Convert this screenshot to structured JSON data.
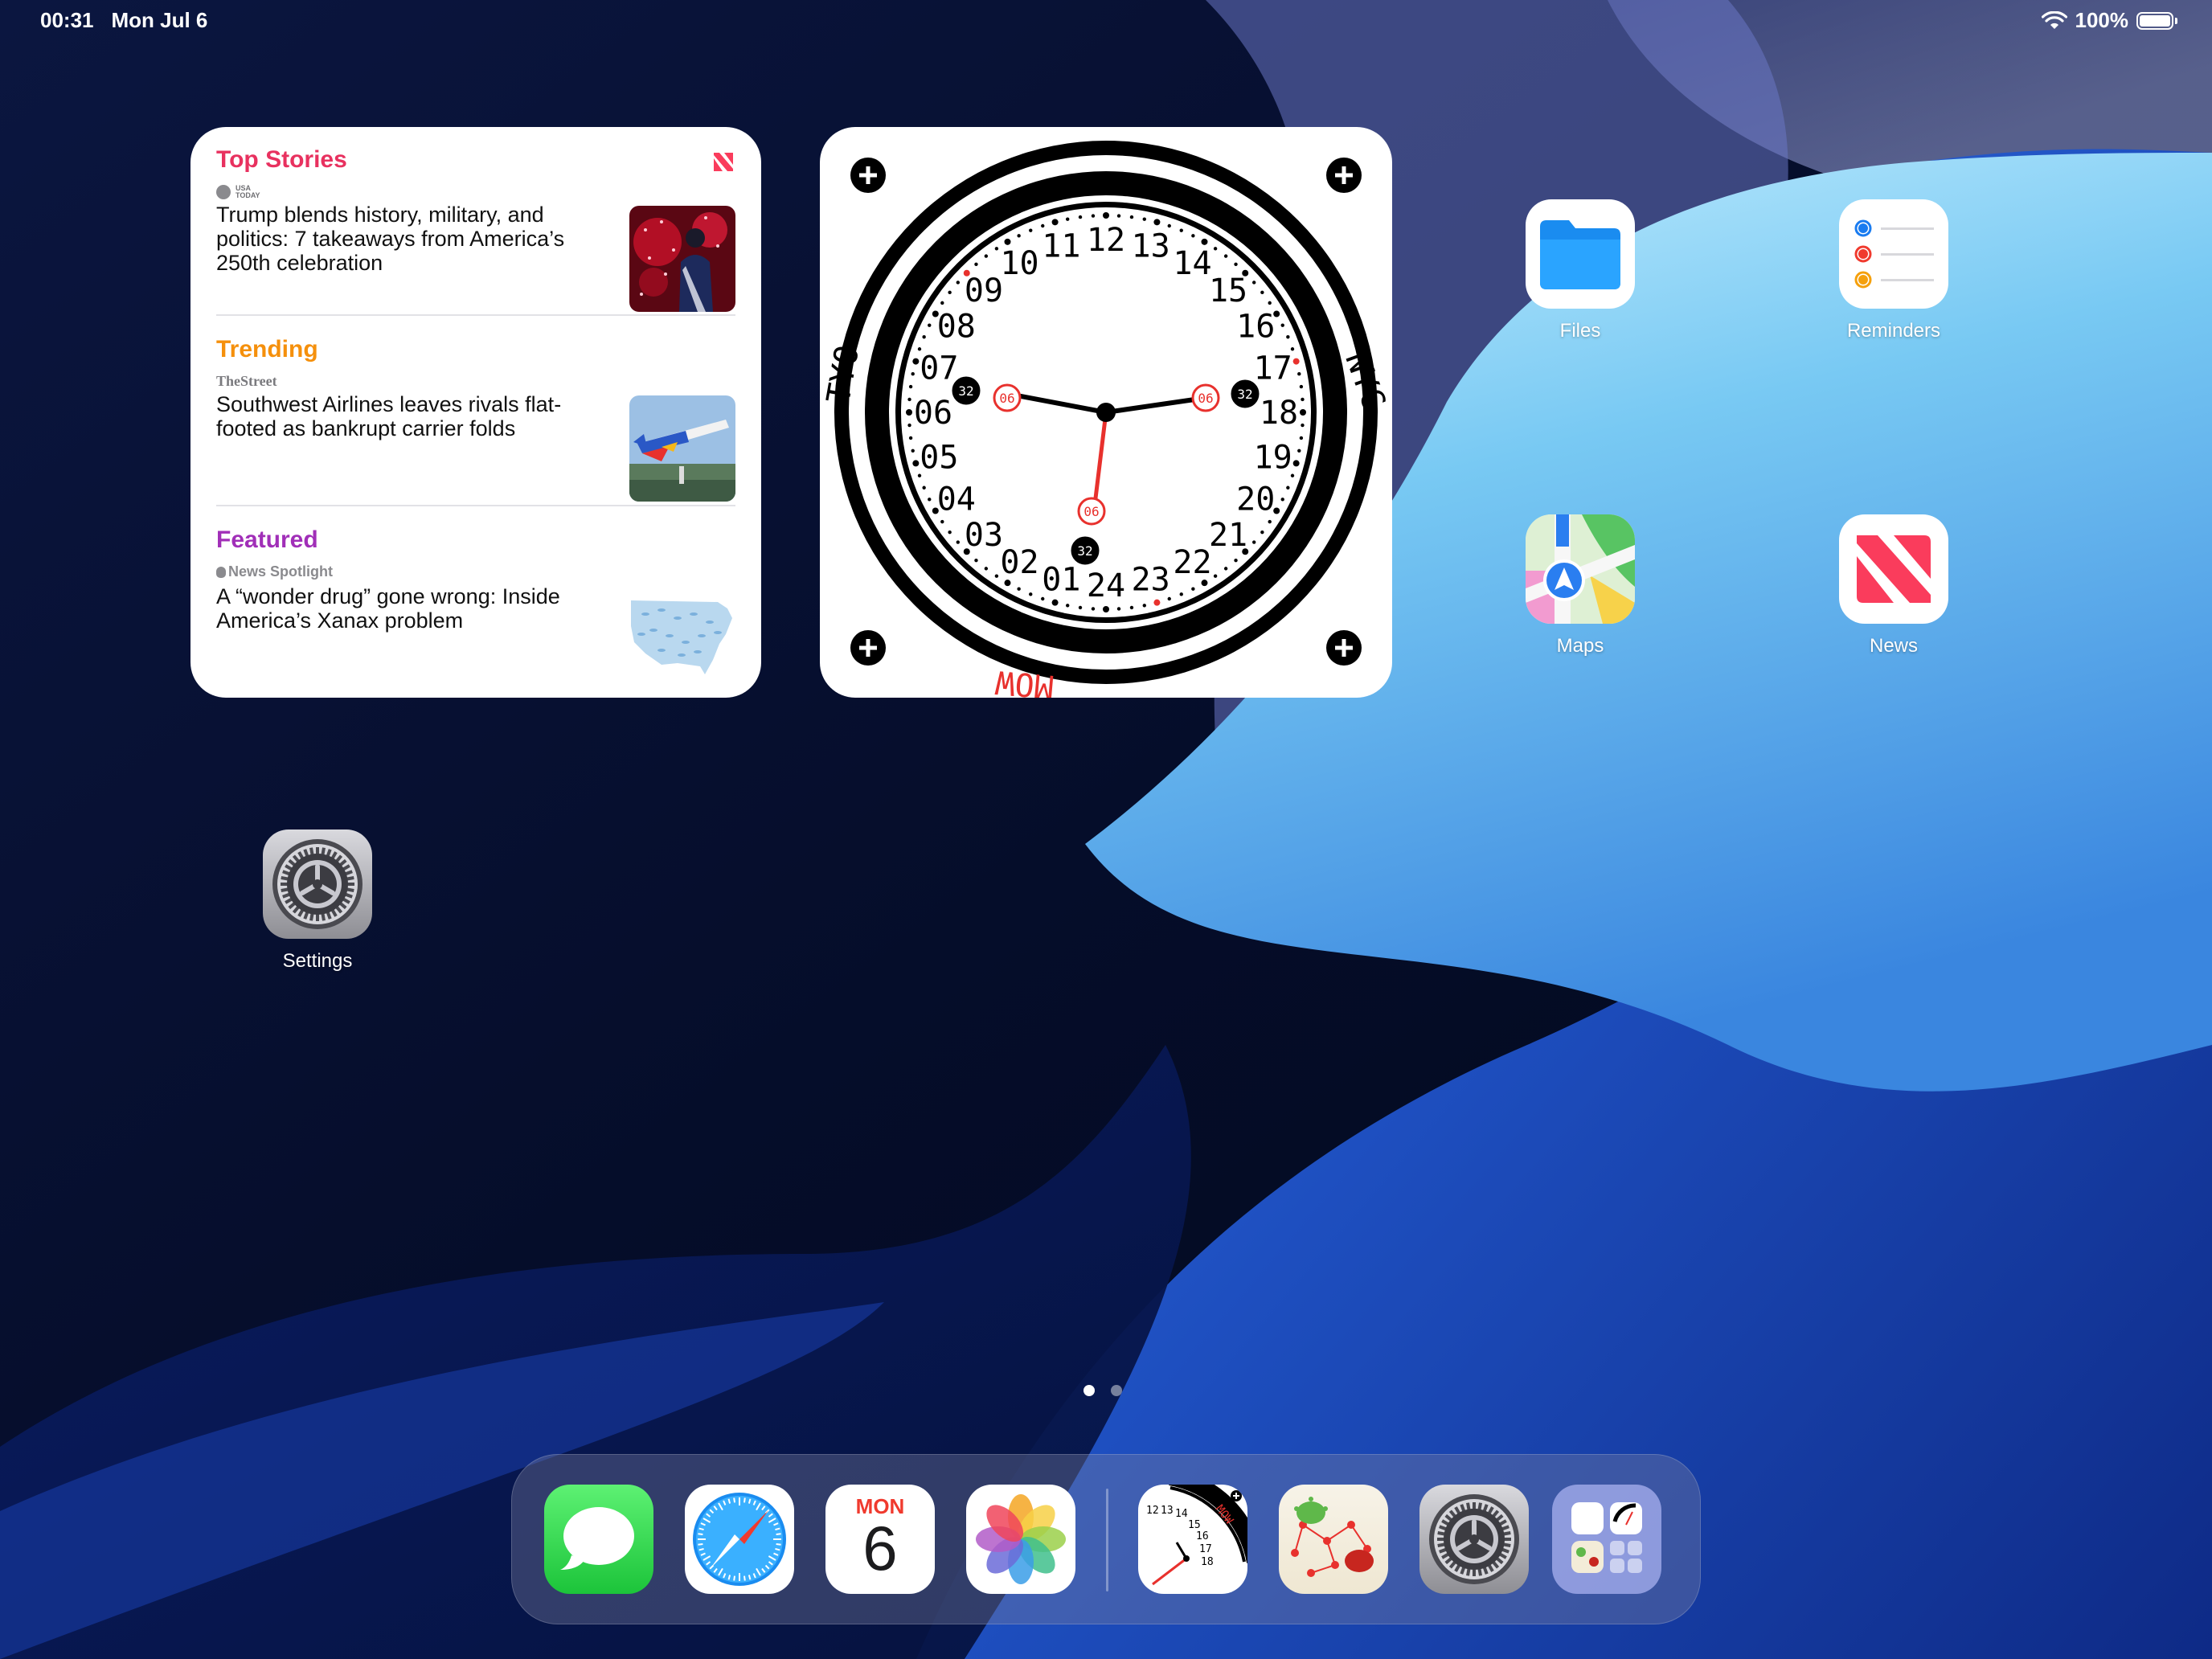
{
  "status_bar": {
    "time": "00:31",
    "date": "Mon Jul 6",
    "battery": "100%"
  },
  "news_widget": {
    "stories": [
      {
        "category": "Top Stories",
        "category_color": "#e8315f",
        "source": "USA TODAY",
        "headline": "Trump blends history, military, and politics: 7 takeaways from America’s 250th celebration"
      },
      {
        "category": "Trending",
        "category_color": "#f5900c",
        "source": "TheStreet",
        "headline": "Southwest Airlines leaves rivals flat-footed as bankrupt carrier folds"
      },
      {
        "category": "Featured",
        "category_color": "#a12fb8",
        "source": "News Spotlight",
        "headline": "A “wonder drug” gone wrong: Inside America’s Xanax problem"
      }
    ]
  },
  "clock_widget": {
    "hour_numerals": [
      "24",
      "01",
      "02",
      "03",
      "04",
      "05",
      "06",
      "07",
      "08",
      "09",
      "10",
      "11",
      "12",
      "13",
      "14",
      "15",
      "16",
      "17",
      "18",
      "19",
      "20",
      "21",
      "22",
      "23"
    ],
    "city_left": "TYO",
    "city_right": "NYC",
    "city_bottom": "MOW",
    "subdial_red": "06",
    "subdial_black": "32"
  },
  "home_apps": [
    {
      "name": "Files"
    },
    {
      "name": "Reminders"
    },
    {
      "name": "Maps"
    },
    {
      "name": "News"
    },
    {
      "name": "Settings"
    }
  ],
  "calendar_icon": {
    "weekday": "MON",
    "day": "6"
  },
  "dock_mini_clock": {
    "numerals": [
      "12",
      "13",
      "14",
      "15",
      "16",
      "17",
      "18"
    ],
    "city": "MOW"
  },
  "page_indicator": {
    "pages": 2,
    "current": 1
  },
  "colors": {
    "accent_red": "#e8315f",
    "wallpaper_dark": "#07122e",
    "wallpaper_light": "#7cc6f2"
  }
}
